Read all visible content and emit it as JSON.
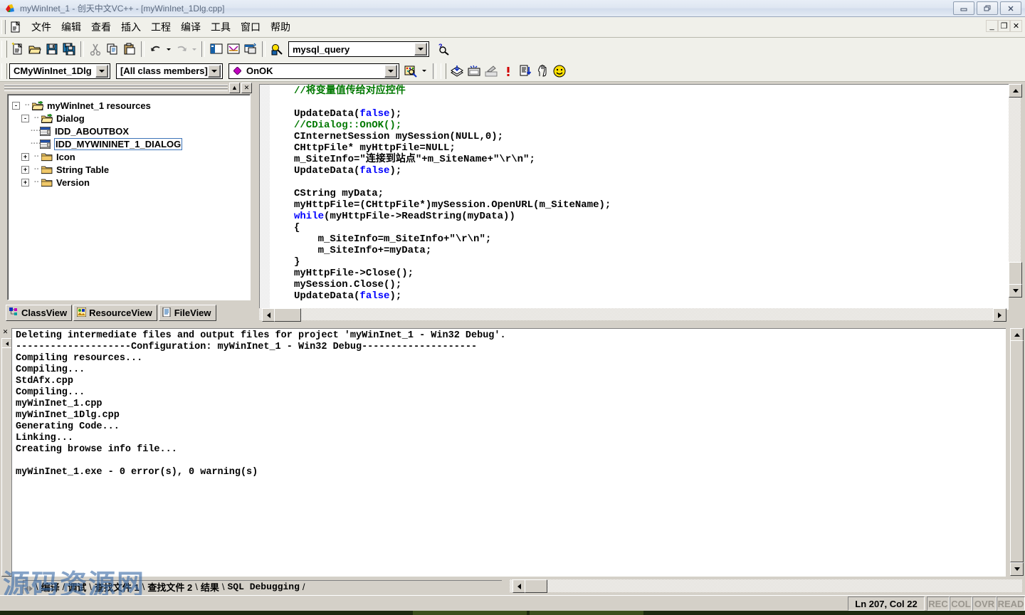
{
  "window": {
    "title": "myWinInet_1 - 创天中文VC++ - [myWinInet_1Dlg.cpp]",
    "app_icon": "vc-app-icon",
    "buttons": {
      "minimize": "—",
      "restore": "❐",
      "close": "✕"
    },
    "mdi_buttons": {
      "minimize": "_",
      "restore": "❐",
      "close": "✕"
    }
  },
  "menubar": {
    "doc_icon": "document-icon",
    "items": [
      {
        "label": "文件"
      },
      {
        "label": "编辑"
      },
      {
        "label": "查看"
      },
      {
        "label": "插入"
      },
      {
        "label": "工程"
      },
      {
        "label": "编译"
      },
      {
        "label": "工具"
      },
      {
        "label": "窗口"
      },
      {
        "label": "帮助"
      }
    ]
  },
  "toolbar_standard": {
    "icons": [
      "new-file-icon",
      "open-folder-icon",
      "save-icon",
      "save-all-icon",
      "cut-icon",
      "copy-icon",
      "paste-icon",
      "undo-icon",
      "redo-icon",
      "workspace-icon",
      "output-window-icon",
      "window-list-icon",
      "find-in-files-icon"
    ],
    "search_combo": {
      "value": "mysql_query",
      "placeholder": ""
    },
    "help_icon": "find-help-icon"
  },
  "toolbar_wizardbar": {
    "class_combo": {
      "value": "CMyWinInet_1Dlg"
    },
    "filter_combo": {
      "value": "[All class members]"
    },
    "member_combo": {
      "value": "OnOK",
      "icon": "member-function-icon"
    },
    "action_icon": "wizardbar-action-icon",
    "build_icons": [
      "compile-icon",
      "build-icon",
      "stop-build-icon",
      "exclamation-icon",
      "execute-program-icon",
      "debug-go-icon",
      "smiley-icon"
    ]
  },
  "workspace": {
    "minimize_label": "▲",
    "close_label": "✕",
    "tree": [
      {
        "indent": 0,
        "expander": "-",
        "icon": "open-folder-icon",
        "label": "myWinInet_1 resources",
        "selected": false
      },
      {
        "indent": 1,
        "expander": "-",
        "icon": "open-folder-icon",
        "label": "Dialog",
        "selected": false
      },
      {
        "indent": 2,
        "expander": "",
        "icon": "dialog-resource-icon",
        "label": "IDD_ABOUTBOX",
        "selected": false
      },
      {
        "indent": 2,
        "expander": "",
        "icon": "dialog-resource-icon",
        "label": "IDD_MYWININET_1_DIALOG",
        "selected": true
      },
      {
        "indent": 1,
        "expander": "+",
        "icon": "closed-folder-icon",
        "label": "Icon",
        "selected": false
      },
      {
        "indent": 1,
        "expander": "+",
        "icon": "closed-folder-icon",
        "label": "String Table",
        "selected": false
      },
      {
        "indent": 1,
        "expander": "+",
        "icon": "closed-folder-icon",
        "label": "Version",
        "selected": false
      }
    ],
    "view_tabs": [
      {
        "label": "ClassView",
        "icon": "classview-icon",
        "active": false
      },
      {
        "label": "ResourceView",
        "icon": "resourceview-icon",
        "active": true
      },
      {
        "label": "FileView",
        "icon": "fileview-icon",
        "active": false
      }
    ]
  },
  "editor": {
    "file": "myWinInet_1Dlg.cpp",
    "lines": [
      [
        {
          "t": "//将变量值传给对应控件",
          "c": "comment"
        }
      ],
      [
        {
          "t": "",
          "c": "plain"
        }
      ],
      [
        {
          "t": "UpdateData(",
          "c": "plain"
        },
        {
          "t": "false",
          "c": "keyword"
        },
        {
          "t": ");",
          "c": "plain"
        }
      ],
      [
        {
          "t": "//CDialog::OnOK();",
          "c": "comment"
        }
      ],
      [
        {
          "t": "CInternetSession mySession(NULL,0);",
          "c": "plain"
        }
      ],
      [
        {
          "t": "CHttpFile* myHttpFile=NULL;",
          "c": "plain"
        }
      ],
      [
        {
          "t": "m_SiteInfo=\"连接到站点\"+m_SiteName+\"\\r\\n\";",
          "c": "plain"
        }
      ],
      [
        {
          "t": "UpdateData(",
          "c": "plain"
        },
        {
          "t": "false",
          "c": "keyword"
        },
        {
          "t": ");",
          "c": "plain"
        }
      ],
      [
        {
          "t": "",
          "c": "plain"
        }
      ],
      [
        {
          "t": "CString myData;",
          "c": "plain"
        }
      ],
      [
        {
          "t": "myHttpFile=(CHttpFile*)mySession.OpenURL(m_SiteName);",
          "c": "plain"
        }
      ],
      [
        {
          "t": "while",
          "c": "keyword"
        },
        {
          "t": "(myHttpFile->ReadString(myData))",
          "c": "plain"
        }
      ],
      [
        {
          "t": "{",
          "c": "plain"
        }
      ],
      [
        {
          "t": "    m_SiteInfo=m_SiteInfo+\"\\r\\n\";",
          "c": "plain"
        }
      ],
      [
        {
          "t": "    m_SiteInfo+=myData;",
          "c": "plain"
        }
      ],
      [
        {
          "t": "}",
          "c": "plain"
        }
      ],
      [
        {
          "t": "myHttpFile->Close();",
          "c": "plain"
        }
      ],
      [
        {
          "t": "mySession.Close();",
          "c": "plain"
        }
      ],
      [
        {
          "t": "UpdateData(",
          "c": "plain"
        },
        {
          "t": "false",
          "c": "keyword"
        },
        {
          "t": ");",
          "c": "plain"
        }
      ]
    ],
    "colors": {
      "comment": "#007800",
      "keyword": "#0000ff",
      "plain": "#000000"
    }
  },
  "output": {
    "close_label": "✕",
    "text": "Deleting intermediate files and output files for project 'myWinInet_1 - Win32 Debug'.\n--------------------Configuration: myWinInet_1 - Win32 Debug--------------------\nCompiling resources...\nCompiling...\nStdAfx.cpp\nCompiling...\nmyWinInet_1.cpp\nmyWinInet_1Dlg.cpp\nGenerating Code...\nLinking...\nCreating browse info file...\n\nmyWinInet_1.exe - 0 error(s), 0 warning(s)",
    "tabs": [
      {
        "label": "编译",
        "active": true,
        "mono": false
      },
      {
        "label": "调试",
        "active": false,
        "mono": false
      },
      {
        "label": "查找文件 1",
        "active": false,
        "mono": false
      },
      {
        "label": "查找文件 2",
        "active": false,
        "mono": false
      },
      {
        "label": "结果",
        "active": false,
        "mono": false
      },
      {
        "label": "SQL Debugging",
        "active": false,
        "mono": true
      }
    ]
  },
  "statusbar": {
    "position": "Ln 207, Col 22",
    "indicators": [
      {
        "label": "REC",
        "on": false
      },
      {
        "label": "COL",
        "on": false
      },
      {
        "label": "OVR",
        "on": false
      },
      {
        "label": "READ",
        "on": false
      }
    ]
  },
  "watermark": {
    "text": "源码资源网",
    "url": "http://www.net188.com"
  },
  "colors": {
    "face": "#d4d0c8",
    "toolbar": "#f0f0ea",
    "selection_border": "#3e74b8",
    "comment_green": "#007800",
    "keyword_blue": "#0000ff",
    "watermark_blue": "#3b6ca8"
  }
}
